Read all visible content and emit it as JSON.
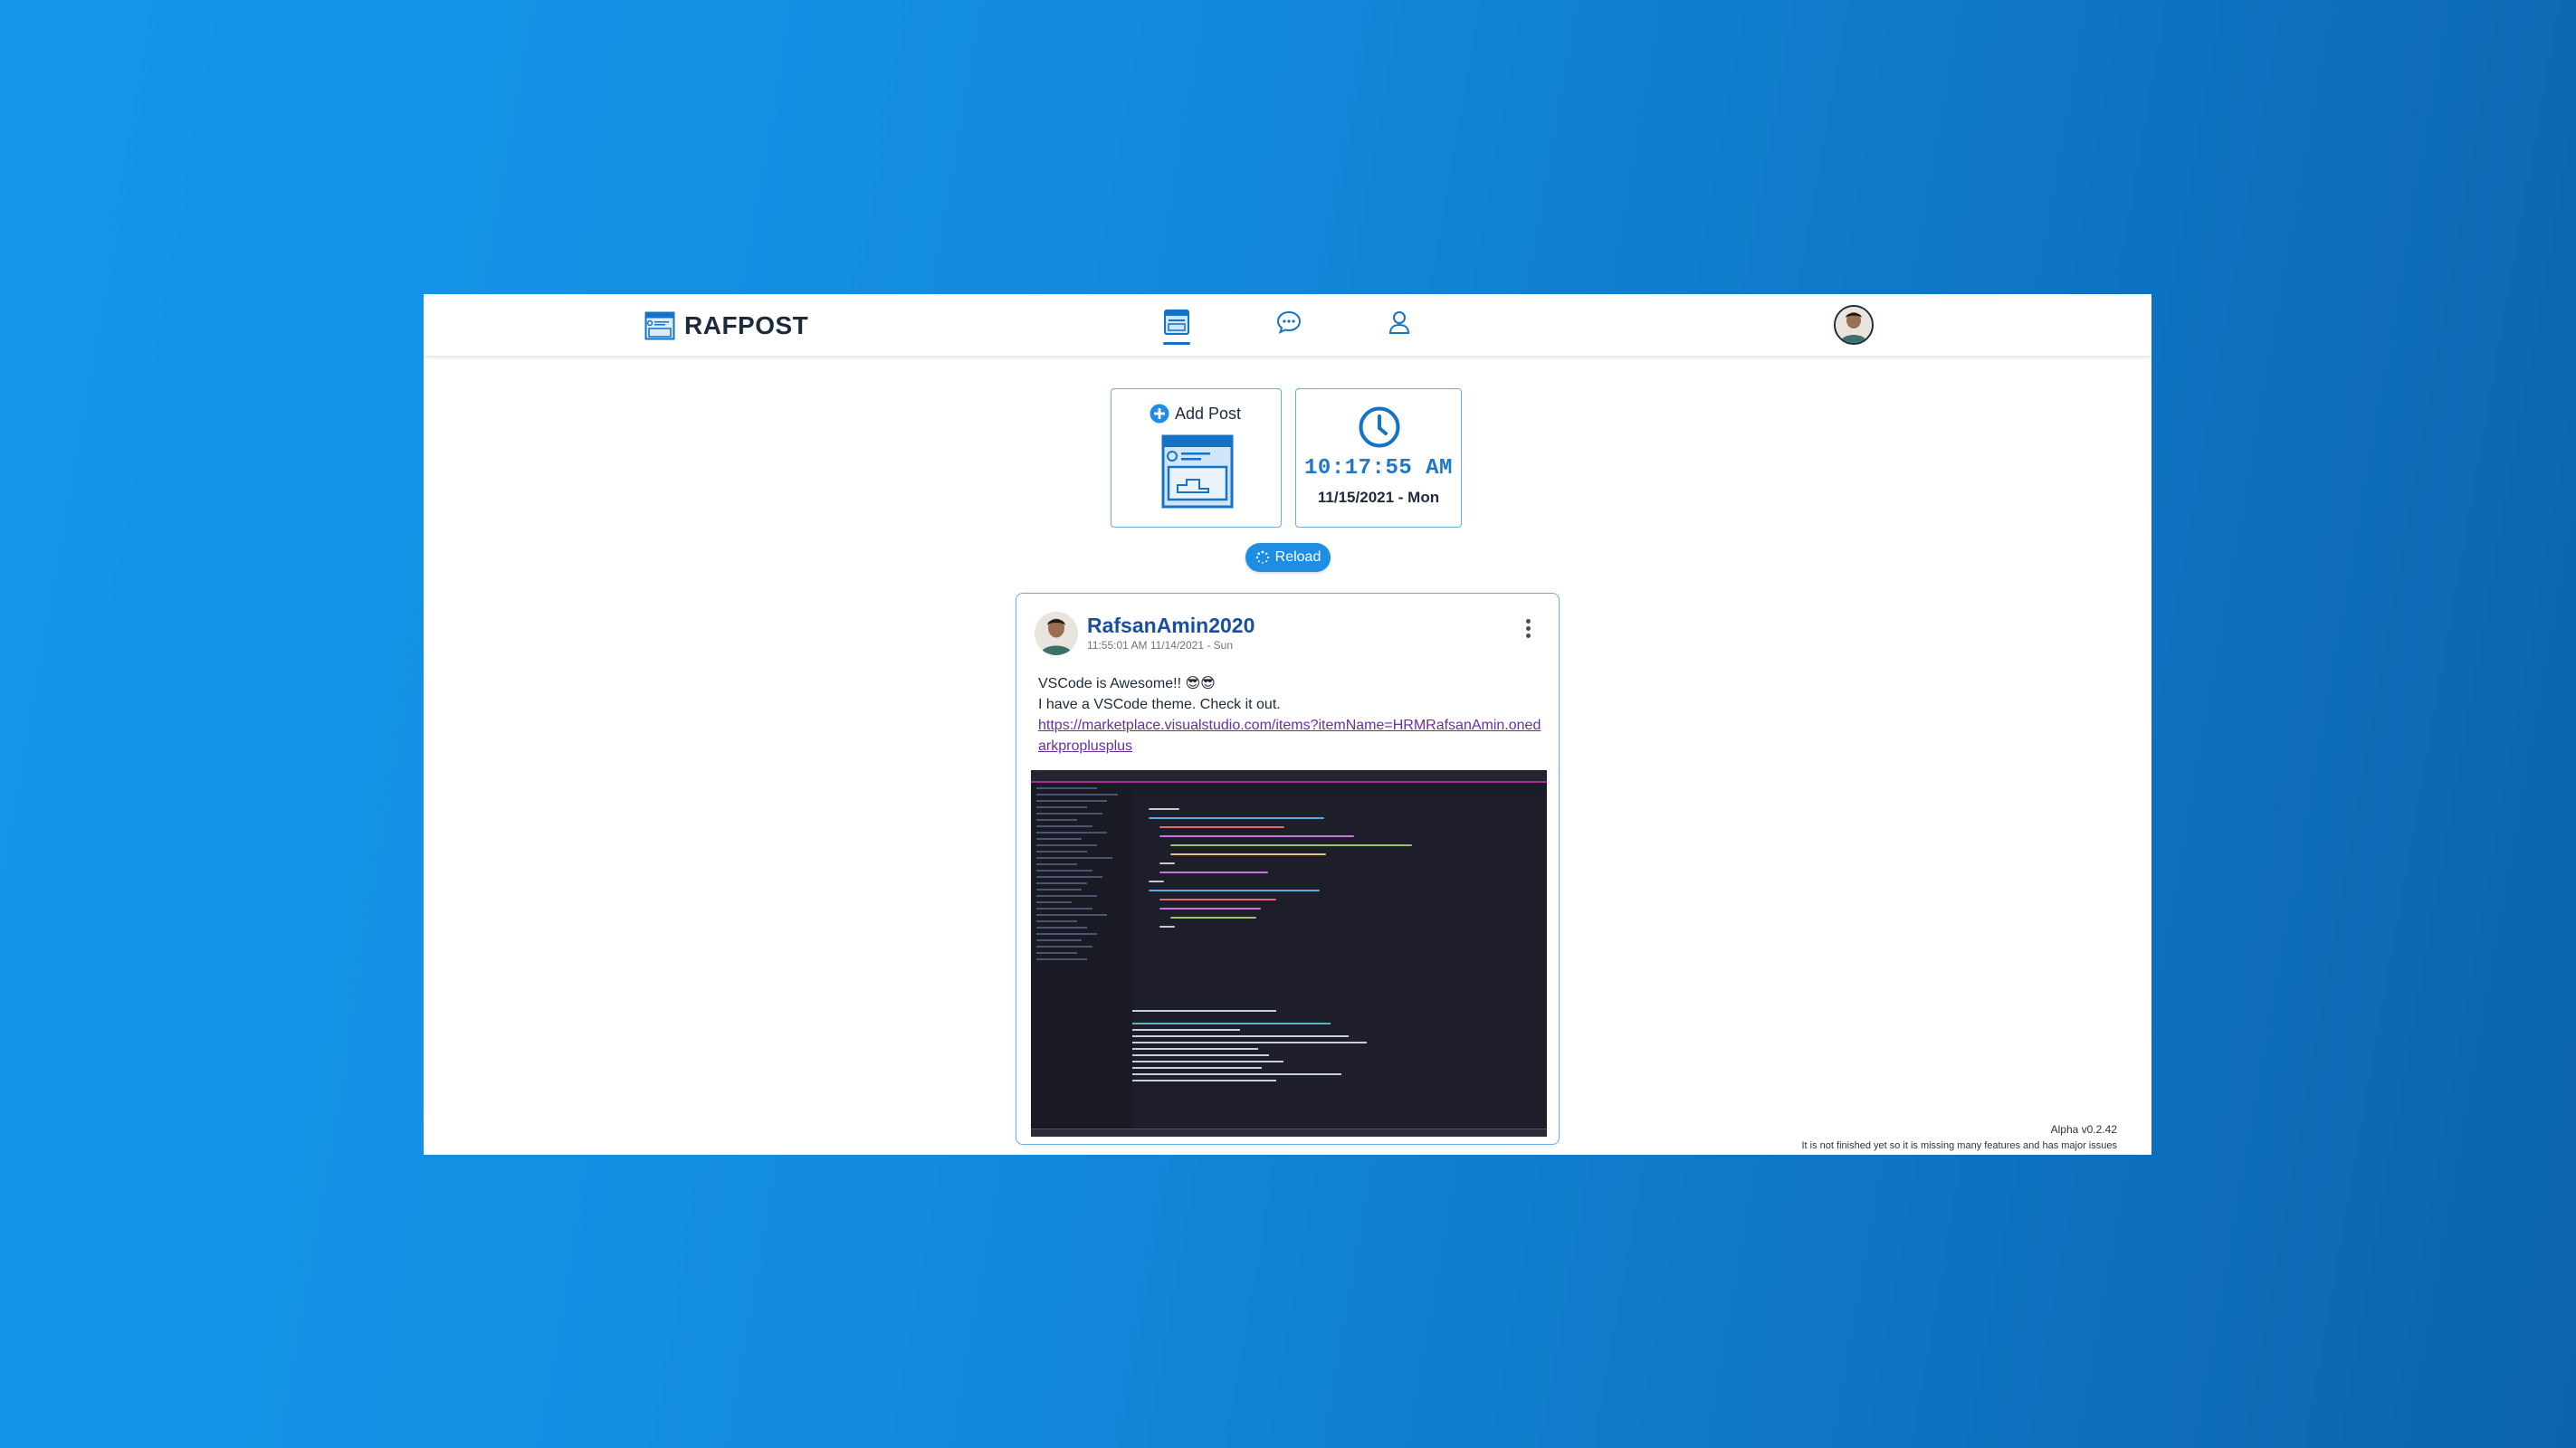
{
  "brand": {
    "name": "RAFPOST"
  },
  "nav": {
    "items": [
      {
        "name": "posts",
        "active": true
      },
      {
        "name": "chat",
        "active": false
      },
      {
        "name": "profile",
        "active": false
      }
    ],
    "accent": "#1572c7"
  },
  "widgets": {
    "add_post_label": "Add Post",
    "clock_time": "10:17:55 AM",
    "clock_date": "11/15/2021 - Mon"
  },
  "reload": {
    "label": "Reload"
  },
  "post": {
    "username": "RafsanAmin2020",
    "timestamp": "11:55:01 AM 11/14/2021 - Sun",
    "line1": "VSCode is Awesome!! 😎😎",
    "line2": "I have a VSCode theme. Check it out.",
    "link": "https://marketplace.visualstudio.com/items?itemName=HRMRafsanAmin.onedarkproplusplus"
  },
  "footer": {
    "version": "Alpha v0.2.42",
    "disclaimer": "It is not finished yet so it is missing many features and has major issues"
  }
}
